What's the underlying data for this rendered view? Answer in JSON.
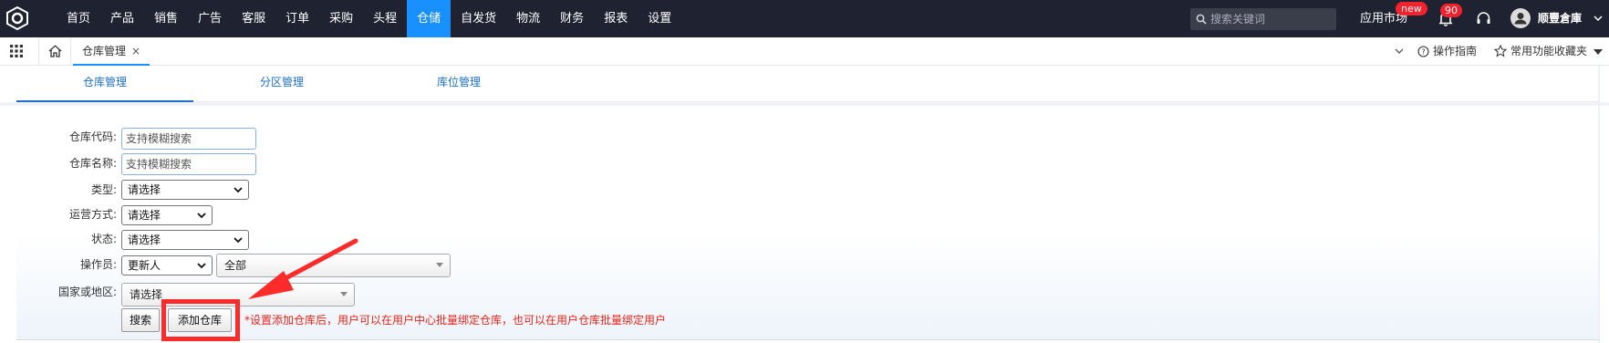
{
  "nav": {
    "items": [
      {
        "label": "首页",
        "active": false
      },
      {
        "label": "产品",
        "active": false
      },
      {
        "label": "销售",
        "active": false
      },
      {
        "label": "广告",
        "active": false
      },
      {
        "label": "客服",
        "active": false
      },
      {
        "label": "订单",
        "active": false
      },
      {
        "label": "采购",
        "active": false
      },
      {
        "label": "头程",
        "active": false
      },
      {
        "label": "仓储",
        "active": true
      },
      {
        "label": "自发货",
        "active": false
      },
      {
        "label": "物流",
        "active": false
      },
      {
        "label": "财务",
        "active": false
      },
      {
        "label": "报表",
        "active": false
      },
      {
        "label": "设置",
        "active": false
      }
    ],
    "search_placeholder": "搜索关键词",
    "app_market": "应用市场",
    "new_badge": "new",
    "notification_count": "90",
    "username": "顺豐倉庫"
  },
  "tabbar": {
    "page_tab": "仓库管理",
    "close_glyph": "×",
    "guide": "操作指南",
    "favorites": "常用功能收藏夹"
  },
  "subtabs": [
    {
      "label": "仓库管理",
      "active": true
    },
    {
      "label": "分区管理",
      "active": false
    },
    {
      "label": "库位管理",
      "active": false
    }
  ],
  "form": {
    "warehouse_code_label": "仓库代码:",
    "warehouse_code_placeholder": "支持模糊搜索",
    "warehouse_name_label": "仓库名称:",
    "warehouse_name_placeholder": "支持模糊搜索",
    "type_label": "类型:",
    "type_value": "请选择",
    "operation_label": "运营方式:",
    "operation_value": "请选择",
    "status_label": "状态:",
    "status_value": "请选择",
    "operator_label": "操作员:",
    "operator_field_value": "更新人",
    "operator_value": "全部",
    "country_label": "国家或地区:",
    "country_value": "请选择",
    "search_button": "搜索",
    "add_button": "添加仓库",
    "hint": "*设置添加仓库后，用户可以在用户中心批量绑定仓库，也可以在用户仓库批量绑定用户"
  },
  "colors": {
    "topbar": "#1f2230",
    "active_nav": "#1890ff",
    "link_blue": "#1e6fc8",
    "highlight_red": "#ff2a2a",
    "hint_red": "#e8251a"
  }
}
